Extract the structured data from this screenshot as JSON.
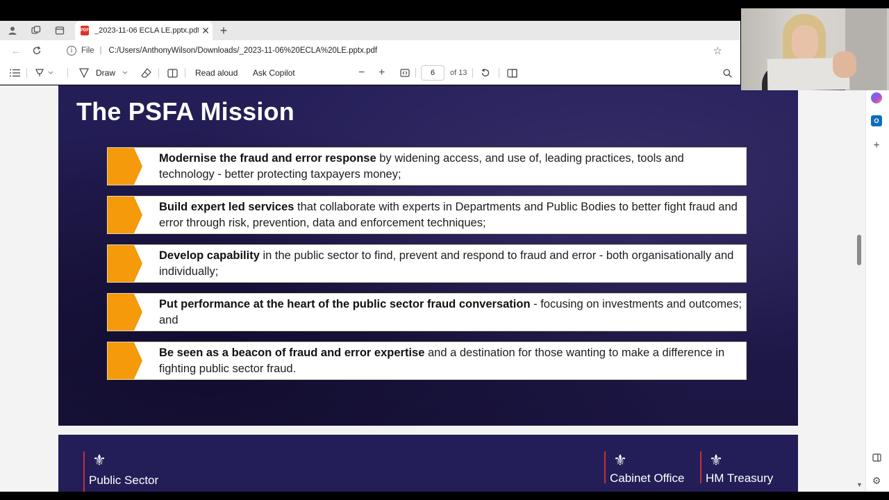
{
  "browser": {
    "tab_title": "_2023-11-06 ECLA LE.pptx.pdf",
    "pdf_badge": "PDF",
    "file_label": "File",
    "address": "C:/Users/AnthonyWilson/Downloads/_2023-11-06%20ECLA%20LE.pptx.pdf",
    "icons": [
      "profile-icon",
      "workspaces-icon",
      "tab-actions-icon",
      "close-icon",
      "new-tab-icon",
      "back-icon",
      "refresh-icon",
      "info-icon",
      "favorite-star-icon"
    ]
  },
  "pdf_toolbar": {
    "draw_label": "Draw",
    "read_aloud_label": "Read aloud",
    "ask_copilot_label": "Ask Copilot",
    "page_number": "6",
    "page_total": "of 13",
    "icons": [
      "contents-icon",
      "highlight-icon",
      "draw-icon",
      "erase-icon",
      "page-view-icon",
      "zoom-out-icon",
      "zoom-in-icon",
      "fit-page-icon",
      "rotate-icon",
      "two-page-icon",
      "search-icon"
    ]
  },
  "slide": {
    "title": "The PSFA Mission",
    "items": [
      {
        "bold": "Modernise the fraud and error response",
        "rest": " by widening access, and use of, leading practices, tools and technology - better protecting taxpayers money;"
      },
      {
        "bold": "Build expert led services",
        "rest": " that collaborate with experts in Departments and Public Bodies to better fight fraud and error through risk, prevention, data and enforcement techniques;"
      },
      {
        "bold": "Develop capability",
        "rest": " in the public sector to find, prevent and respond to fraud and error - both organisationally and individually;"
      },
      {
        "bold": "Put performance at the heart of the public sector fraud conversation",
        "rest": " - focusing on investments and outcomes; and"
      },
      {
        "bold": "Be seen as a beacon of fraud and error expertise",
        "rest": " and a destination for those wanting to make a difference in fighting public sector fraud."
      }
    ],
    "colors": {
      "background": "#1f1a4d",
      "chevron": "#f49a0b",
      "box_border": "#e2d7b4"
    }
  },
  "next_slide": {
    "logos": [
      {
        "text": "Public Sector",
        "icon": "royal-crest-icon"
      },
      {
        "text": "Cabinet Office",
        "icon": "royal-crest-icon"
      },
      {
        "text": "HM Treasury",
        "icon": "royal-crest-icon"
      }
    ]
  },
  "side_panel": {
    "icons": [
      "copilot-icon",
      "outlook-icon",
      "add-icon",
      "sidebar-toggle-icon",
      "settings-icon"
    ],
    "outlook_letter": "O"
  }
}
